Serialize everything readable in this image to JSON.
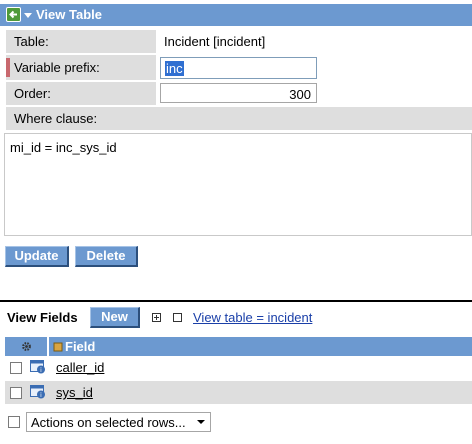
{
  "header": {
    "title": "View Table"
  },
  "form": {
    "table": {
      "label": "Table:",
      "value": "Incident [incident]"
    },
    "variable_prefix": {
      "label": "Variable prefix:",
      "value": "inc"
    },
    "order": {
      "label": "Order:",
      "value": "300"
    },
    "where_clause": {
      "label": "Where clause:",
      "value": "mi_id = inc_sys_id"
    }
  },
  "buttons": {
    "update": "Update",
    "delete": "Delete"
  },
  "view_fields": {
    "title": "View Fields",
    "new_button": "New",
    "filter_link": "View table = incident",
    "column_header": "Field",
    "rows": [
      {
        "field": "caller_id"
      },
      {
        "field": "sys_id"
      }
    ],
    "actions_select": "Actions on selected rows..."
  },
  "colors": {
    "accent": "#6c99d0",
    "label_bg": "#dedede",
    "required": "#c8686e",
    "selection": "#2f6fd1"
  }
}
